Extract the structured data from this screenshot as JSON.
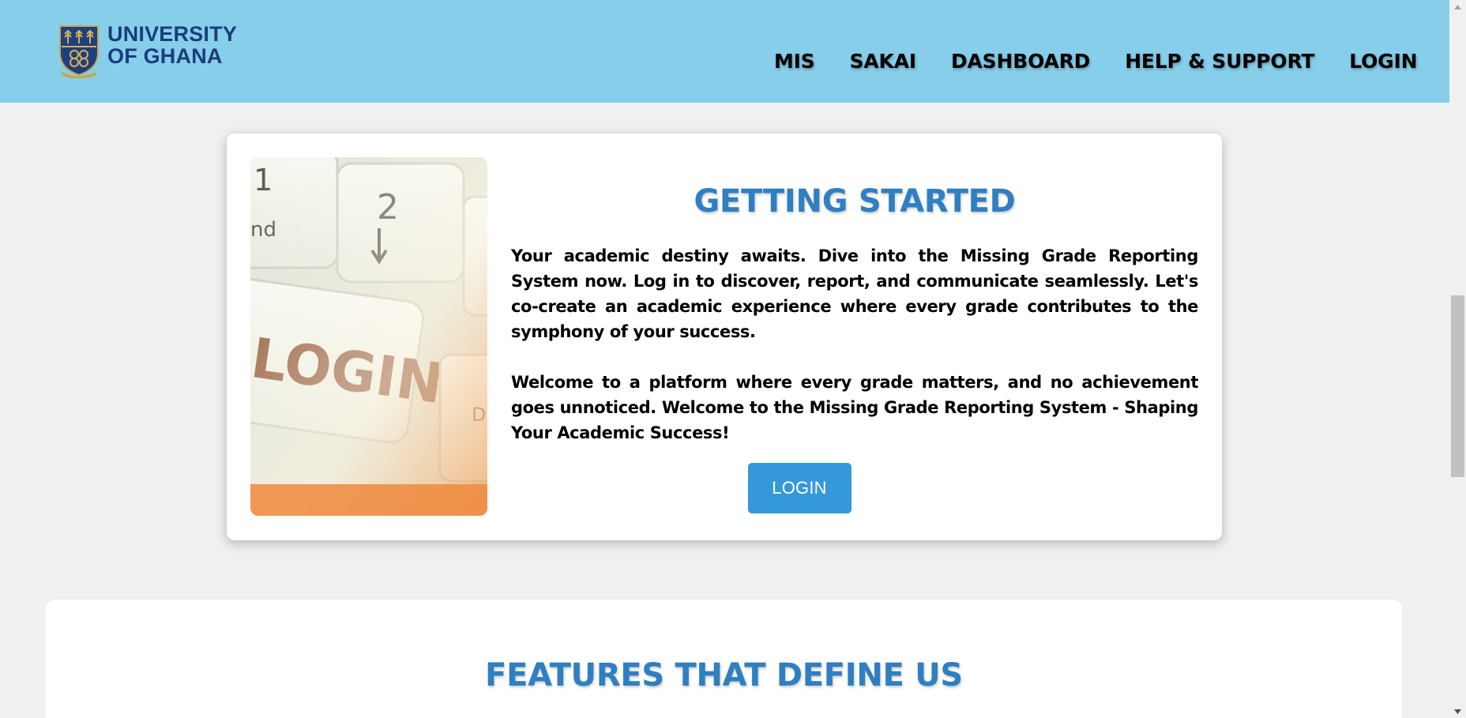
{
  "header": {
    "brand": {
      "line1": "UNIVERSITY",
      "line2": "OF GHANA",
      "crest_icon": "university-crest-icon"
    },
    "nav": [
      {
        "id": "mis",
        "label": "MIS"
      },
      {
        "id": "sakai",
        "label": "SAKAI"
      },
      {
        "id": "dashboard",
        "label": "DASHBOARD"
      },
      {
        "id": "help",
        "label": "HELP & SUPPORT"
      },
      {
        "id": "login",
        "label": "LOGIN"
      }
    ]
  },
  "getting_started": {
    "title": "GETTING STARTED",
    "image_icon": "keyboard-login-photo",
    "paragraph1": "Your academic destiny awaits. Dive into the Missing Grade Reporting System now. Log in to discover, report, and communicate seamlessly. Let's co-create an academic experience where every grade contributes to the symphony of your success.",
    "paragraph2": "Welcome to a platform where every grade matters, and no achievement goes unnoticed. Welcome to the Missing Grade Reporting System - Shaping Your Academic Success!",
    "button_label": "LOGIN"
  },
  "features": {
    "title": "FEATURES THAT DEFINE US"
  },
  "colors": {
    "header_bg": "#87ceeb",
    "page_bg": "#f0f0f0",
    "accent_title": "#2f7fc1",
    "button_bg": "#3498db",
    "brand_text": "#1b3d7b"
  }
}
